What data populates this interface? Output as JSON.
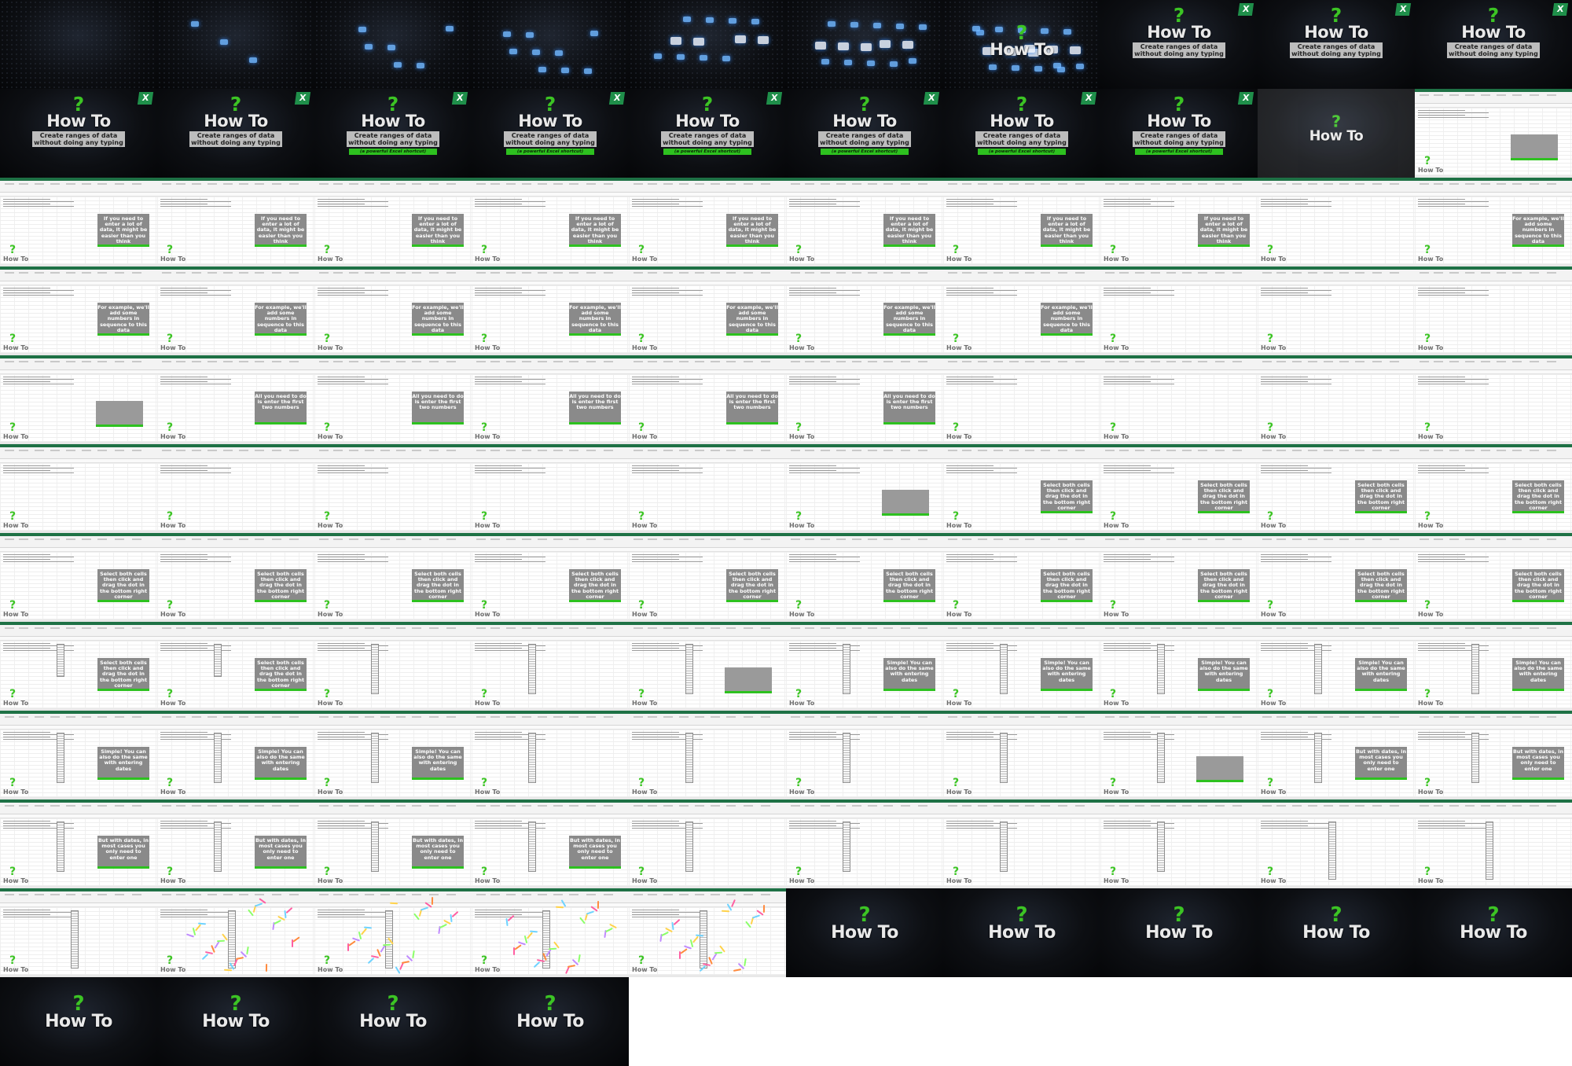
{
  "logo": {
    "name": "How To",
    "glyph": "?",
    "brand_color": "#3cc424"
  },
  "excel_badge": "X",
  "title_card": {
    "subtitle_line1": "Create ranges of data",
    "subtitle_line2": "without doing any typing",
    "tagline": "(a powerful Excel shortcut)"
  },
  "captions": {
    "c1": "If you need to enter a lot of data, it might be easier than you think",
    "c2": "For example, we'll add some numbers in sequence to this data",
    "c3": "All you need to do is enter the first two numbers",
    "c4": "Select both cells then click and drag the dot in the bottom right corner",
    "c5": "Simple! You can also do the same with entering dates",
    "c6": "But with dates, in most cases you only need to enter one"
  },
  "frames": [
    {
      "kind": "intro",
      "stage": 0
    },
    {
      "kind": "intro",
      "stage": 1
    },
    {
      "kind": "intro",
      "stage": 2
    },
    {
      "kind": "intro",
      "stage": 3
    },
    {
      "kind": "intro",
      "stage": 4
    },
    {
      "kind": "intro",
      "stage": 5
    },
    {
      "kind": "intro",
      "stage": 6
    },
    {
      "kind": "title",
      "subtitle": true,
      "tagline": false
    },
    {
      "kind": "title",
      "subtitle": true,
      "tagline": false
    },
    {
      "kind": "title",
      "subtitle": true,
      "tagline": false
    },
    {
      "kind": "title",
      "subtitle": true,
      "tagline": false
    },
    {
      "kind": "title",
      "subtitle": true,
      "tagline": false
    },
    {
      "kind": "title",
      "subtitle": true,
      "tagline": true
    },
    {
      "kind": "title",
      "subtitle": true,
      "tagline": true
    },
    {
      "kind": "title",
      "subtitle": true,
      "tagline": true
    },
    {
      "kind": "title",
      "subtitle": true,
      "tagline": true
    },
    {
      "kind": "title",
      "subtitle": true,
      "tagline": true
    },
    {
      "kind": "title",
      "subtitle": true,
      "tagline": true
    },
    {
      "kind": "fade"
    },
    {
      "kind": "excel",
      "box": true
    },
    {
      "kind": "excel",
      "caption": "c1"
    },
    {
      "kind": "excel",
      "caption": "c1"
    },
    {
      "kind": "excel",
      "caption": "c1"
    },
    {
      "kind": "excel",
      "caption": "c1"
    },
    {
      "kind": "excel",
      "caption": "c1"
    },
    {
      "kind": "excel",
      "caption": "c1"
    },
    {
      "kind": "excel",
      "caption": "c1"
    },
    {
      "kind": "excel",
      "caption": "c1"
    },
    {
      "kind": "excel"
    },
    {
      "kind": "excel",
      "caption": "c2"
    },
    {
      "kind": "excel",
      "caption": "c2"
    },
    {
      "kind": "excel",
      "caption": "c2"
    },
    {
      "kind": "excel",
      "caption": "c2"
    },
    {
      "kind": "excel",
      "caption": "c2"
    },
    {
      "kind": "excel",
      "caption": "c2"
    },
    {
      "kind": "excel",
      "caption": "c2"
    },
    {
      "kind": "excel",
      "caption": "c2"
    },
    {
      "kind": "excel"
    },
    {
      "kind": "excel"
    },
    {
      "kind": "excel"
    },
    {
      "kind": "excel",
      "box": true
    },
    {
      "kind": "excel",
      "caption": "c3"
    },
    {
      "kind": "excel",
      "caption": "c3"
    },
    {
      "kind": "excel",
      "caption": "c3"
    },
    {
      "kind": "excel",
      "caption": "c3"
    },
    {
      "kind": "excel",
      "caption": "c3"
    },
    {
      "kind": "excel"
    },
    {
      "kind": "excel"
    },
    {
      "kind": "excel"
    },
    {
      "kind": "excel"
    },
    {
      "kind": "excel"
    },
    {
      "kind": "excel"
    },
    {
      "kind": "excel"
    },
    {
      "kind": "excel"
    },
    {
      "kind": "excel"
    },
    {
      "kind": "excel",
      "box": true
    },
    {
      "kind": "excel",
      "caption": "c4"
    },
    {
      "kind": "excel",
      "caption": "c4"
    },
    {
      "kind": "excel",
      "caption": "c4"
    },
    {
      "kind": "excel",
      "caption": "c4"
    },
    {
      "kind": "excel",
      "caption": "c4"
    },
    {
      "kind": "excel",
      "caption": "c4"
    },
    {
      "kind": "excel",
      "caption": "c4"
    },
    {
      "kind": "excel",
      "caption": "c4"
    },
    {
      "kind": "excel",
      "caption": "c4"
    },
    {
      "kind": "excel",
      "caption": "c4"
    },
    {
      "kind": "excel",
      "caption": "c4"
    },
    {
      "kind": "excel",
      "caption": "c4"
    },
    {
      "kind": "excel",
      "caption": "c4"
    },
    {
      "kind": "excel",
      "caption": "c4"
    },
    {
      "kind": "excel",
      "caption": "c4",
      "col": 1
    },
    {
      "kind": "excel",
      "caption": "c4",
      "col": 1
    },
    {
      "kind": "excel",
      "col": 2
    },
    {
      "kind": "excel",
      "col": 2
    },
    {
      "kind": "excel",
      "col": 2,
      "box": true
    },
    {
      "kind": "excel",
      "caption": "c5",
      "col": 2
    },
    {
      "kind": "excel",
      "caption": "c5",
      "col": 2
    },
    {
      "kind": "excel",
      "caption": "c5",
      "col": 2
    },
    {
      "kind": "excel",
      "caption": "c5",
      "col": 2
    },
    {
      "kind": "excel",
      "caption": "c5",
      "col": 2
    },
    {
      "kind": "excel",
      "caption": "c5",
      "col": 2
    },
    {
      "kind": "excel",
      "caption": "c5",
      "col": 2
    },
    {
      "kind": "excel",
      "caption": "c5",
      "col": 2
    },
    {
      "kind": "excel",
      "col": 2
    },
    {
      "kind": "excel",
      "col": 2
    },
    {
      "kind": "excel",
      "col": 2
    },
    {
      "kind": "excel",
      "col": 2
    },
    {
      "kind": "excel",
      "col": 2,
      "box": true
    },
    {
      "kind": "excel",
      "caption": "c6",
      "col": 2
    },
    {
      "kind": "excel",
      "caption": "c6",
      "col": 2
    },
    {
      "kind": "excel",
      "caption": "c6",
      "col": 2
    },
    {
      "kind": "excel",
      "caption": "c6",
      "col": 2
    },
    {
      "kind": "excel",
      "caption": "c6",
      "col": 2
    },
    {
      "kind": "excel",
      "caption": "c6",
      "col": 2
    },
    {
      "kind": "excel",
      "col": 2
    },
    {
      "kind": "excel",
      "col": 2
    },
    {
      "kind": "excel",
      "col": 2
    },
    {
      "kind": "excel",
      "col": 2
    },
    {
      "kind": "excel",
      "col": 3
    },
    {
      "kind": "excel",
      "col": 3
    },
    {
      "kind": "excel",
      "col": 3
    },
    {
      "kind": "excel",
      "col": 3,
      "confetti": true
    },
    {
      "kind": "excel",
      "col": 3,
      "confetti": true
    },
    {
      "kind": "excel",
      "col": 3,
      "confetti": true
    },
    {
      "kind": "excel",
      "col": 3,
      "confetti": true
    },
    {
      "kind": "logo"
    },
    {
      "kind": "logo"
    },
    {
      "kind": "logo"
    },
    {
      "kind": "logo"
    },
    {
      "kind": "logo"
    },
    {
      "kind": "logo"
    },
    {
      "kind": "logo"
    },
    {
      "kind": "logo"
    },
    {
      "kind": "logo"
    },
    {
      "kind": "empty"
    },
    {
      "kind": "empty"
    },
    {
      "kind": "empty"
    },
    {
      "kind": "empty"
    },
    {
      "kind": "empty"
    },
    {
      "kind": "empty"
    }
  ]
}
